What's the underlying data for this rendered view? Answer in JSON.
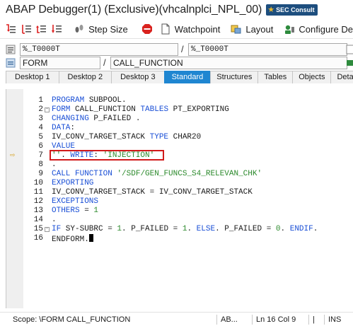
{
  "window": {
    "title": "ABAP Debugger(1)  (Exclusive)(vhcalnplci_NPL_00)",
    "logo_text": "SEC Consult"
  },
  "toolbar": {
    "step_size_label": "Step Size",
    "watchpoint_label": "Watchpoint",
    "layout_label": "Layout",
    "configure_label": "Configure De"
  },
  "fields": {
    "program_1": "%_T0000T",
    "slash": "/",
    "program_2": "%_T0000T",
    "event_type": "FORM",
    "event_name": "CALL_FUNCTION"
  },
  "tabs": [
    "Desktop 1",
    "Desktop 2",
    "Desktop 3",
    "Standard",
    "Structures",
    "Tables",
    "Objects",
    "Detail"
  ],
  "code": {
    "lines": [
      {
        "n": "1",
        "fold": "",
        "segs": [
          {
            "c": "kw",
            "t": "PROGRAM"
          },
          {
            "c": "tx",
            "t": " SUBPOOL."
          }
        ]
      },
      {
        "n": "2",
        "fold": "-",
        "segs": [
          {
            "c": "kw",
            "t": "FORM"
          },
          {
            "c": "tx",
            "t": " CALL_FUNCTION "
          },
          {
            "c": "kw",
            "t": "TABLES"
          },
          {
            "c": "tx",
            "t": " PT_EXPORTING"
          }
        ]
      },
      {
        "n": "3",
        "fold": "",
        "segs": [
          {
            "c": "kw",
            "t": "CHANGING"
          },
          {
            "c": "tx",
            "t": " P_FAILED ."
          }
        ]
      },
      {
        "n": "4",
        "fold": "",
        "segs": [
          {
            "c": "kw",
            "t": "DATA"
          },
          {
            "c": "tx",
            "t": ":"
          }
        ]
      },
      {
        "n": "5",
        "fold": "",
        "segs": [
          {
            "c": "tx",
            "t": "IV_CONV_TARGET_STACK "
          },
          {
            "c": "kw",
            "t": "TYPE"
          },
          {
            "c": "tx",
            "t": " CHAR20"
          }
        ]
      },
      {
        "n": "6",
        "fold": "",
        "segs": [
          {
            "c": "kw",
            "t": "VALUE"
          }
        ]
      },
      {
        "n": "7",
        "fold": "",
        "segs": [
          {
            "c": "st",
            "t": "''"
          },
          {
            "c": "tx",
            "t": ". "
          },
          {
            "c": "kw",
            "t": "WRITE"
          },
          {
            "c": "tx",
            "t": ": "
          },
          {
            "c": "st",
            "t": "'INJECTION'"
          }
        ]
      },
      {
        "n": "8",
        "fold": "",
        "segs": [
          {
            "c": "tx",
            "t": "."
          }
        ]
      },
      {
        "n": "9",
        "fold": "",
        "segs": [
          {
            "c": "kw",
            "t": "CALL FUNCTION"
          },
          {
            "c": "tx",
            "t": " "
          },
          {
            "c": "st",
            "t": "'/SDF/GEN_FUNCS_S4_RELEVAN_CHK'"
          }
        ]
      },
      {
        "n": "10",
        "fold": "",
        "segs": [
          {
            "c": "kw",
            "t": "EXPORTING"
          }
        ]
      },
      {
        "n": "11",
        "fold": "",
        "segs": [
          {
            "c": "tx",
            "t": "IV_CONV_TARGET_STACK = IV_CONV_TARGET_STACK"
          }
        ]
      },
      {
        "n": "12",
        "fold": "",
        "segs": [
          {
            "c": "kw",
            "t": "EXCEPTIONS"
          }
        ]
      },
      {
        "n": "13",
        "fold": "",
        "segs": [
          {
            "c": "kw",
            "t": "OTHERS"
          },
          {
            "c": "tx",
            "t": " = "
          },
          {
            "c": "st",
            "t": "1"
          }
        ]
      },
      {
        "n": "14",
        "fold": "",
        "segs": [
          {
            "c": "tx",
            "t": "."
          }
        ]
      },
      {
        "n": "15",
        "fold": "-",
        "segs": [
          {
            "c": "kw",
            "t": "IF"
          },
          {
            "c": "tx",
            "t": " SY-SUBRC = "
          },
          {
            "c": "st",
            "t": "1"
          },
          {
            "c": "tx",
            "t": ". P_FAILED = "
          },
          {
            "c": "st",
            "t": "1"
          },
          {
            "c": "tx",
            "t": ". "
          },
          {
            "c": "kw",
            "t": "ELSE"
          },
          {
            "c": "tx",
            "t": ". P_FAILED = "
          },
          {
            "c": "st",
            "t": "0"
          },
          {
            "c": "tx",
            "t": ". "
          },
          {
            "c": "kw",
            "t": "ENDIF"
          },
          {
            "c": "tx",
            "t": "."
          }
        ]
      },
      {
        "n": "16",
        "fold": "",
        "segs": [
          {
            "c": "tx",
            "t": "ENDFORM."
          }
        ]
      }
    ],
    "current_line": "7",
    "cursor_line": "16"
  },
  "status": {
    "scope": "Scope: \\FORM CALL_FUNCTION",
    "lang": "AB...",
    "ln": "Ln  16 Col   9",
    "flag": "|",
    "mode": "INS"
  },
  "colors": {
    "keyword": "#1a4fd6",
    "string": "#2c8a2c",
    "active_tab": "#1f86d1",
    "highlight": "#d11a1a"
  }
}
